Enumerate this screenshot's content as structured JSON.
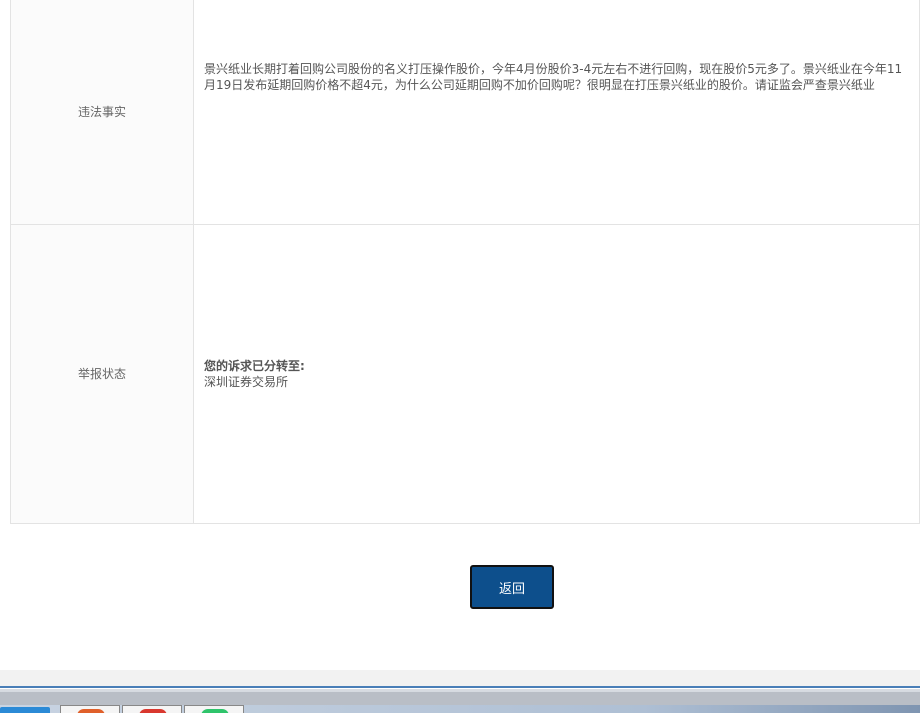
{
  "table": {
    "rows": [
      {
        "label": "违法事实",
        "value": "景兴纸业长期打着回购公司股份的名义打压操作股价，今年4月份股价3-4元左右不进行回购，现在股价5元多了。景兴纸业在今年11月19日发布延期回购价格不超4元，为什么公司延期回购不加价回购呢？很明显在打压景兴纸业的股价。请证监会严查景兴纸业"
      },
      {
        "label": "举报状态",
        "status_title": "您的诉求已分转至:",
        "status_dest": "深圳证券交易所"
      }
    ]
  },
  "actions": {
    "back_label": "返回"
  },
  "colors": {
    "button_bg": "#0d4f8c",
    "border": "#e3e3e3",
    "label_bg": "#fbfbfb"
  }
}
